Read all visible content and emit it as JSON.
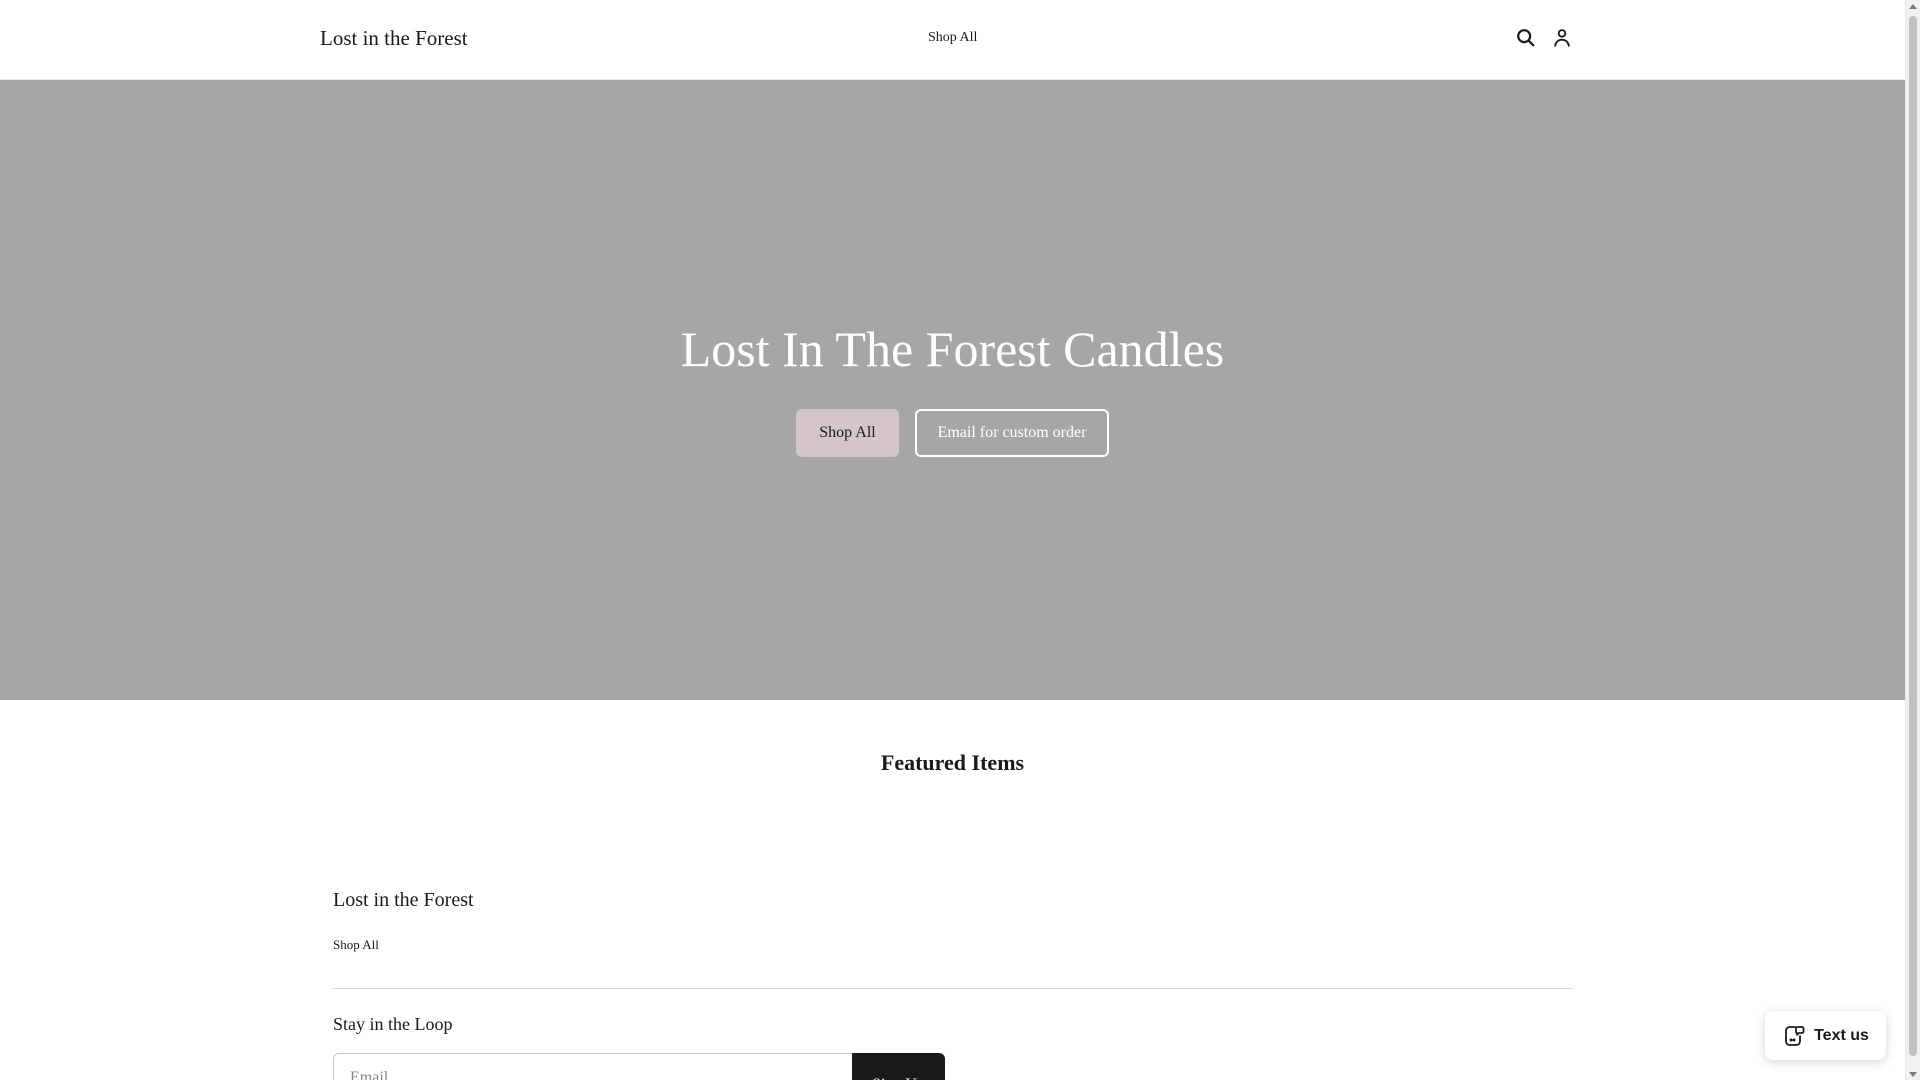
{
  "header": {
    "logo": "Lost in the Forest",
    "nav": {
      "shop_all": "Shop All"
    },
    "icons": {
      "search": "search-icon",
      "account": "account-icon"
    }
  },
  "hero": {
    "title": "Lost In The Forest Candles",
    "primary_button": "Shop All",
    "secondary_button": "Email for custom order",
    "colors": {
      "background": "#a6a6a6",
      "primary_button_bg": "#d3c5c8"
    }
  },
  "featured": {
    "title": "Featured Items"
  },
  "footer": {
    "logo": "Lost in the Forest",
    "links": {
      "shop_all": "Shop All"
    },
    "newsletter": {
      "title": "Stay in the Loop",
      "email_placeholder": "Email",
      "submit_label": "Sign Up"
    }
  },
  "chat_widget": {
    "label": "Text us",
    "icon": "text-message-icon"
  }
}
